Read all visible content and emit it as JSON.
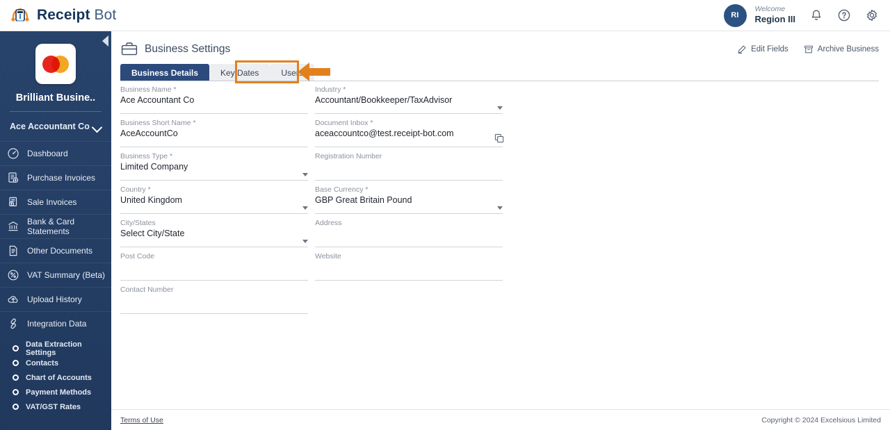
{
  "app": {
    "brand_bold": "Receipt",
    "brand_light": " Bot",
    "logo_icon": "receipt-bot-logo"
  },
  "topbar": {
    "avatar_initials": "RI",
    "welcome_label": "Welcome",
    "user_name": "Region III",
    "icons": [
      {
        "name": "notification-bell-icon",
        "glyph": "bell"
      },
      {
        "name": "help-icon",
        "glyph": "question-circle"
      },
      {
        "name": "settings-gear-icon",
        "glyph": "gear"
      }
    ]
  },
  "sidebar": {
    "collapse_icon": "collapse-left-icon",
    "business_logo_icon": "mastercard-logo",
    "business_name": "Brilliant Busine..",
    "account_switcher": "Ace Accountant Co",
    "account_switcher_icon": "chevron-down-icon",
    "items": [
      {
        "label": "Dashboard",
        "icon": "dashboard-icon"
      },
      {
        "label": "Purchase Invoices",
        "icon": "purchase-invoice-icon"
      },
      {
        "label": "Sale Invoices",
        "icon": "sale-invoice-icon"
      },
      {
        "label": "Bank & Card Statements",
        "icon": "bank-icon"
      },
      {
        "label": "Other Documents",
        "icon": "document-icon"
      },
      {
        "label": "VAT Summary (Beta)",
        "icon": "percent-circle-icon"
      },
      {
        "label": "Upload History",
        "icon": "upload-cloud-icon"
      },
      {
        "label": "Integration Data",
        "icon": "link-icon"
      }
    ],
    "sub_items": [
      {
        "label": "Data Extraction Settings",
        "icon": "circle-bullet-icon"
      },
      {
        "label": "Contacts",
        "icon": "circle-bullet-icon"
      },
      {
        "label": "Chart of Accounts",
        "icon": "circle-bullet-icon"
      },
      {
        "label": "Payment Methods",
        "icon": "circle-bullet-icon"
      },
      {
        "label": "VAT/GST Rates",
        "icon": "circle-bullet-icon"
      }
    ]
  },
  "page": {
    "title": "Business Settings",
    "title_icon": "briefcase-icon",
    "actions": [
      {
        "label": "Edit Fields",
        "icon": "pencil-icon"
      },
      {
        "label": "Archive Business",
        "icon": "archive-box-icon"
      }
    ],
    "tabs": [
      {
        "label": "Business Details",
        "active": true
      },
      {
        "label": "Key Dates",
        "active": false
      },
      {
        "label": "Users",
        "active": false
      }
    ],
    "highlight": {
      "target_tab": "Users",
      "color": "#e2801e",
      "arrow_icon": "left-pointing-arrow"
    }
  },
  "form": {
    "left": [
      {
        "label": "Business Name *",
        "value": "Ace Accountant Co",
        "type": "text",
        "name": "business-name-field"
      },
      {
        "label": "Business Short Name *",
        "value": "AceAccountCo",
        "type": "text",
        "name": "business-short-name-field"
      },
      {
        "label": "Business Type *",
        "value": "Limited Company",
        "type": "select",
        "name": "business-type-select"
      },
      {
        "label": "Country *",
        "value": "United Kingdom",
        "type": "select",
        "name": "country-select"
      },
      {
        "label": "City/States",
        "value": "Select City/State",
        "type": "select",
        "name": "city-state-select"
      },
      {
        "label": "Post Code",
        "value": "",
        "type": "text",
        "name": "post-code-field"
      },
      {
        "label": "Contact Number",
        "value": "",
        "type": "text",
        "name": "contact-number-field"
      }
    ],
    "right": [
      {
        "label": "Industry *",
        "value": "Accountant/Bookkeeper/TaxAdvisor",
        "type": "select",
        "name": "industry-select"
      },
      {
        "label": "Document Inbox *",
        "value": "aceaccountco@test.receipt-bot.com",
        "type": "copy",
        "name": "document-inbox-field"
      },
      {
        "label": "Registration Number",
        "value": "",
        "type": "text",
        "name": "registration-number-field"
      },
      {
        "label": "Base Currency *",
        "value": "GBP Great Britain Pound",
        "type": "select",
        "name": "base-currency-select"
      },
      {
        "label": "Address",
        "value": "",
        "type": "text",
        "name": "address-field"
      },
      {
        "label": "Website",
        "value": "",
        "type": "text",
        "name": "website-field"
      }
    ]
  },
  "footer": {
    "terms": "Terms of Use",
    "copyright": "Copyright © 2024 Excelsious Limited"
  },
  "colors": {
    "sidebar_bg": "#28436b",
    "tab_active": "#2c4a7c",
    "accent_orange": "#e2801e",
    "avatar_bg": "#2c5282"
  }
}
